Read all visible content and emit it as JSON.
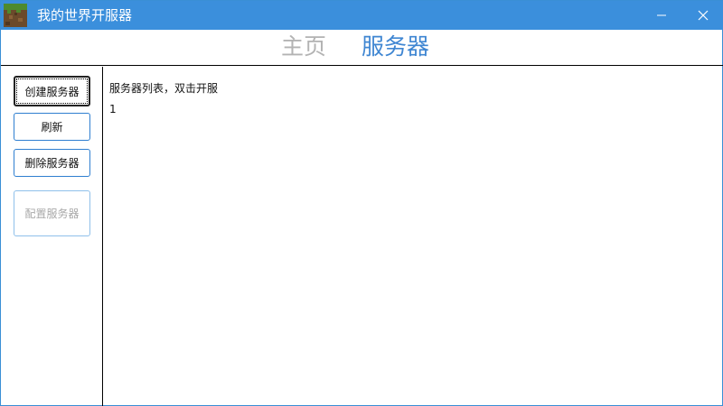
{
  "window": {
    "title": "我的世界开服器",
    "icon": "minecraft-grass-block-icon",
    "accent_color": "#3b8fdc"
  },
  "nav": {
    "tabs": [
      {
        "label": "主页",
        "active": false
      },
      {
        "label": "服务器",
        "active": true
      }
    ]
  },
  "sidebar": {
    "create_label": "创建服务器",
    "refresh_label": "刷新",
    "delete_label": "删除服务器",
    "config_label": "配置服务器"
  },
  "server_list": {
    "header": "服务器列表，双击开服",
    "items": [
      "1"
    ]
  }
}
